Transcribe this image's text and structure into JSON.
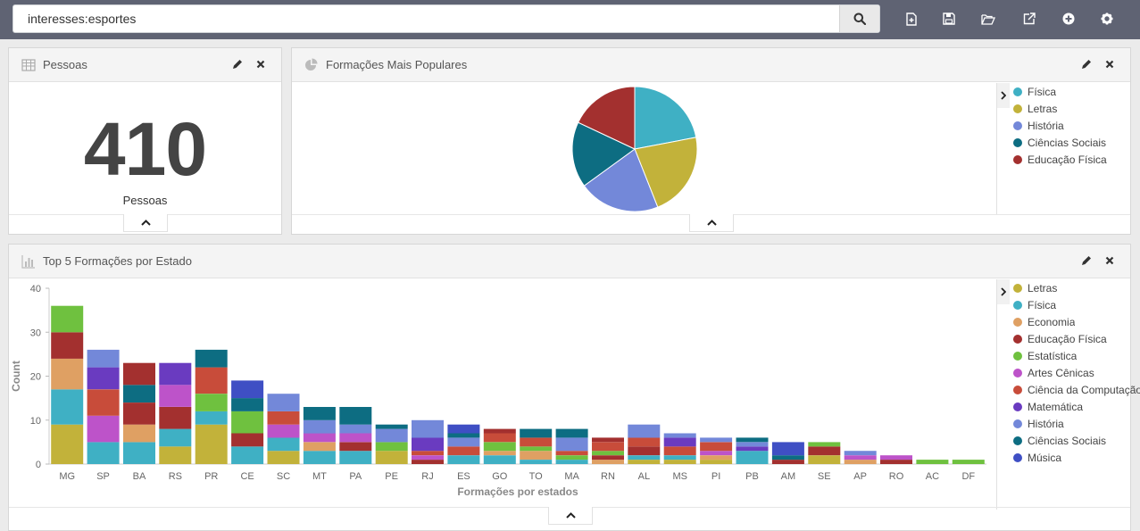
{
  "search": {
    "value": "interesses:esportes"
  },
  "toolbar": {
    "icons": [
      "new-dashboard-icon",
      "save-icon",
      "open-icon",
      "share-icon",
      "add-icon",
      "settings-icon"
    ]
  },
  "panels": {
    "pessoas": {
      "title": "Pessoas",
      "value": "410",
      "label": "Pessoas"
    },
    "formacoes": {
      "title": "Formações Mais Populares",
      "legend": [
        {
          "label": "Física",
          "color": "#3fb0c4"
        },
        {
          "label": "Letras",
          "color": "#c2b23a"
        },
        {
          "label": "História",
          "color": "#7388d9"
        },
        {
          "label": "Ciências Sociais",
          "color": "#0d6d82"
        },
        {
          "label": "Educação Física",
          "color": "#a3302f"
        }
      ]
    },
    "estados": {
      "title": "Top 5 Formações por Estado",
      "legend": [
        {
          "label": "Letras",
          "color": "#c2b23a"
        },
        {
          "label": "Física",
          "color": "#3fb0c4"
        },
        {
          "label": "Economia",
          "color": "#dfa063"
        },
        {
          "label": "Educação Física",
          "color": "#a3302f"
        },
        {
          "label": "Estatística",
          "color": "#6fc13f"
        },
        {
          "label": "Artes Cênicas",
          "color": "#bd53c9"
        },
        {
          "label": "Ciência da Computação",
          "color": "#c84c3a"
        },
        {
          "label": "Matemática",
          "color": "#6a3bc0"
        },
        {
          "label": "História",
          "color": "#7388d9"
        },
        {
          "label": "Ciências Sociais",
          "color": "#0d6d82"
        },
        {
          "label": "Música",
          "color": "#3f4fc4"
        }
      ]
    }
  },
  "chart_data": [
    {
      "type": "pie",
      "title": "Formações Mais Populares",
      "slices": [
        {
          "name": "Física",
          "value": 22
        },
        {
          "name": "Letras",
          "value": 22
        },
        {
          "name": "História",
          "value": 21
        },
        {
          "name": "Ciências Sociais",
          "value": 17
        },
        {
          "name": "Educação Física",
          "value": 18
        }
      ]
    },
    {
      "type": "bar",
      "title": "Top 5 Formações por Estado",
      "xlabel": "Formações por estados",
      "ylabel": "Count",
      "ylim": [
        0,
        40
      ],
      "yticks": [
        0,
        10,
        20,
        30,
        40
      ],
      "categories": [
        "MG",
        "SP",
        "BA",
        "RS",
        "PR",
        "CE",
        "SC",
        "MT",
        "PA",
        "PE",
        "RJ",
        "ES",
        "GO",
        "TO",
        "MA",
        "RN",
        "AL",
        "MS",
        "PI",
        "PB",
        "AM",
        "SE",
        "AP",
        "RO",
        "AC",
        "DF"
      ],
      "series": [
        {
          "name": "Letras",
          "values": [
            9,
            0,
            0,
            4,
            9,
            0,
            3,
            0,
            0,
            3,
            0,
            0,
            0,
            0,
            0,
            0,
            1,
            1,
            1,
            0,
            0,
            2,
            0,
            0,
            0,
            0
          ]
        },
        {
          "name": "Física",
          "values": [
            8,
            5,
            5,
            4,
            3,
            4,
            3,
            3,
            3,
            0,
            0,
            2,
            2,
            1,
            1,
            0,
            1,
            1,
            0,
            3,
            0,
            0,
            0,
            0,
            0,
            0
          ]
        },
        {
          "name": "Economia",
          "values": [
            7,
            0,
            4,
            0,
            0,
            0,
            0,
            2,
            0,
            0,
            0,
            0,
            1,
            2,
            0,
            1,
            0,
            0,
            1,
            0,
            0,
            0,
            1,
            0,
            0,
            0
          ]
        },
        {
          "name": "Educação Física",
          "values": [
            6,
            0,
            5,
            5,
            0,
            3,
            0,
            0,
            2,
            0,
            1,
            0,
            0,
            0,
            0,
            1,
            2,
            0,
            0,
            0,
            1,
            2,
            0,
            1,
            0,
            0
          ]
        },
        {
          "name": "Estatística",
          "values": [
            6,
            0,
            0,
            0,
            4,
            5,
            0,
            0,
            0,
            2,
            0,
            0,
            2,
            1,
            1,
            1,
            0,
            0,
            0,
            0,
            0,
            1,
            0,
            0,
            1,
            1
          ]
        },
        {
          "name": "Artes Cênicas",
          "values": [
            0,
            6,
            0,
            5,
            0,
            0,
            3,
            2,
            2,
            0,
            1,
            0,
            0,
            0,
            0,
            0,
            0,
            0,
            1,
            0,
            0,
            0,
            1,
            1,
            0,
            0
          ]
        },
        {
          "name": "Ciência da Computação",
          "values": [
            0,
            6,
            0,
            0,
            6,
            0,
            3,
            0,
            0,
            0,
            1,
            2,
            2,
            2,
            1,
            2,
            2,
            2,
            2,
            0,
            0,
            0,
            0,
            0,
            0,
            0
          ]
        },
        {
          "name": "Matemática",
          "values": [
            0,
            5,
            0,
            5,
            0,
            0,
            0,
            0,
            0,
            0,
            3,
            0,
            0,
            0,
            0,
            0,
            0,
            2,
            0,
            1,
            0,
            0,
            0,
            0,
            0,
            0
          ]
        },
        {
          "name": "História",
          "values": [
            0,
            4,
            0,
            0,
            0,
            0,
            4,
            3,
            2,
            3,
            4,
            2,
            0,
            0,
            3,
            0,
            3,
            1,
            1,
            1,
            0,
            0,
            1,
            0,
            0,
            0
          ]
        },
        {
          "name": "Ciências Sociais",
          "values": [
            0,
            0,
            4,
            0,
            4,
            3,
            0,
            3,
            4,
            1,
            0,
            1,
            0,
            2,
            2,
            0,
            0,
            0,
            0,
            1,
            1,
            0,
            0,
            0,
            0,
            0
          ]
        },
        {
          "name": "Música",
          "values": [
            0,
            0,
            0,
            0,
            0,
            4,
            0,
            0,
            0,
            0,
            0,
            2,
            0,
            0,
            0,
            0,
            0,
            0,
            0,
            0,
            3,
            0,
            0,
            0,
            0,
            0
          ]
        },
        {
          "name": "Educação Física",
          "values": [
            0,
            0,
            5,
            0,
            0,
            0,
            0,
            0,
            0,
            0,
            0,
            0,
            1,
            0,
            0,
            1,
            0,
            0,
            0,
            0,
            0,
            0,
            0,
            0,
            0,
            0
          ]
        }
      ]
    }
  ]
}
